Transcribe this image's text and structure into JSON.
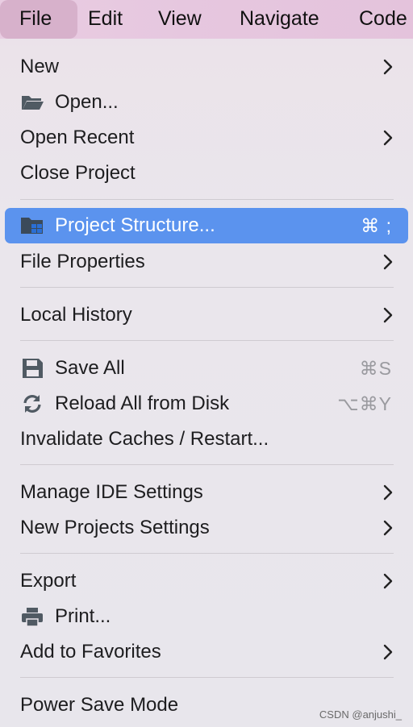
{
  "menubar": {
    "items": [
      {
        "label": "File"
      },
      {
        "label": "Edit"
      },
      {
        "label": "View"
      },
      {
        "label": "Navigate"
      },
      {
        "label": "Code"
      }
    ]
  },
  "menu": {
    "new": {
      "label": "New"
    },
    "open": {
      "label": "Open...",
      "icon": "folder-open-icon"
    },
    "open_recent": {
      "label": "Open Recent"
    },
    "close_project": {
      "label": "Close Project"
    },
    "project_structure": {
      "label": "Project Structure...",
      "shortcut": "⌘ ;",
      "icon": "project-structure-icon"
    },
    "file_properties": {
      "label": "File Properties"
    },
    "local_history": {
      "label": "Local History"
    },
    "save_all": {
      "label": "Save All",
      "shortcut": "⌘S",
      "icon": "save-icon"
    },
    "reload_all": {
      "label": "Reload All from Disk",
      "shortcut": "⌥⌘Y",
      "icon": "reload-icon"
    },
    "invalidate_caches": {
      "label": "Invalidate Caches / Restart..."
    },
    "manage_ide_settings": {
      "label": "Manage IDE Settings"
    },
    "new_projects_settings": {
      "label": "New Projects Settings"
    },
    "export": {
      "label": "Export"
    },
    "print": {
      "label": "Print...",
      "icon": "printer-icon"
    },
    "add_to_favorites": {
      "label": "Add to Favorites"
    },
    "power_save_mode": {
      "label": "Power Save Mode"
    }
  },
  "colors": {
    "selection": "#5b93ee",
    "menubar_active": "#d7b1cb"
  },
  "watermark": "CSDN @anjushi_"
}
